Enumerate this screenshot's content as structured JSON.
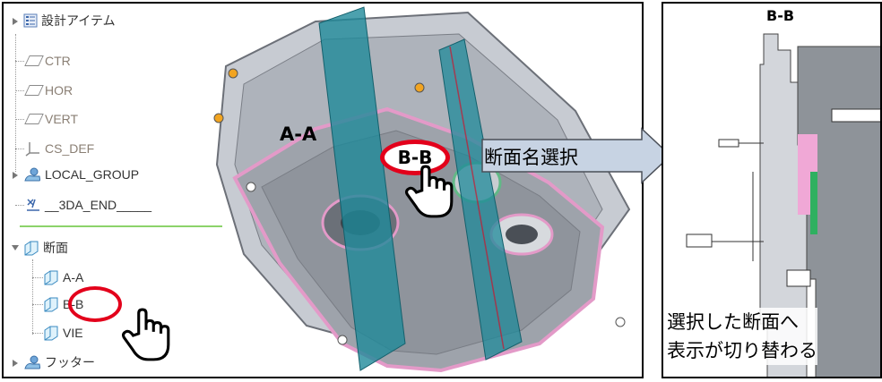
{
  "tree": {
    "items": [
      {
        "label": "設計アイテム"
      },
      {
        "label": "CTR"
      },
      {
        "label": "HOR"
      },
      {
        "label": "VERT"
      },
      {
        "label": "CS_DEF"
      },
      {
        "label": "LOCAL_GROUP"
      },
      {
        "label": "__3DA_END_____"
      },
      {
        "label": "断面"
      },
      {
        "label": "A-A"
      },
      {
        "label": "B-B"
      },
      {
        "label": "VIE"
      },
      {
        "label": "フッター"
      }
    ]
  },
  "view": {
    "section_a_label": "A-A",
    "section_b_label": "B-B"
  },
  "callout": {
    "text": "断面名選択"
  },
  "section_view": {
    "title": "B-B",
    "note_line1": "選択した断面へ",
    "note_line2": "表示が切り替わる"
  },
  "colors": {
    "highlight": "#e3001b",
    "section_plane": "#1f8a9a",
    "callout_fill": "#c7d3e3",
    "model_edge_pink": "#e39ac8"
  }
}
